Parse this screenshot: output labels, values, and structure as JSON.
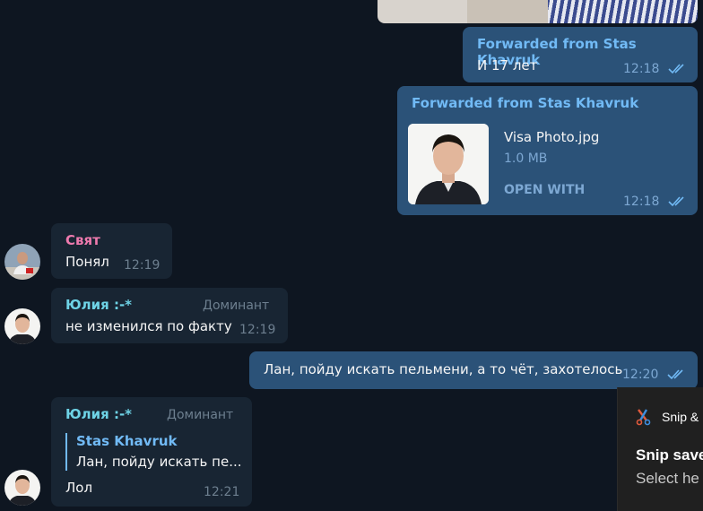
{
  "messages": {
    "fwd1": {
      "label": "Forwarded from Stas Khavruk",
      "text": "И 17 лет",
      "time": "12:18"
    },
    "fwd2": {
      "label": "Forwarded from Stas Khavruk",
      "file_name": "Visa Photo.jpg",
      "file_size": "1.0 MB",
      "open_with": "OPEN WITH",
      "time": "12:18"
    },
    "m1": {
      "sender": "Свят",
      "text": "Понял",
      "time": "12:19"
    },
    "m2": {
      "sender": "Юлия :-*",
      "role": "Доминант",
      "text": "не изменился по факту",
      "time": "12:19"
    },
    "m3": {
      "text": "Лан, пойду искать пельмени, а то чёт, захотелось",
      "time": "12:20"
    },
    "m4": {
      "sender": "Юлия :-*",
      "role": "Доминант",
      "reply_author": "Stas Khavruk",
      "reply_text": "Лан, пойду искать пе...",
      "text": "Лол",
      "time": "12:21"
    }
  },
  "toast": {
    "app": "Snip &",
    "title": "Snip save",
    "subtitle": "Select he"
  },
  "colors": {
    "background": "#0e1621",
    "outgoing": "#2b5278",
    "incoming": "#182533",
    "accent": "#71baf5",
    "sender_pink": "#ee7aae",
    "sender_cyan": "#6ed3e6"
  }
}
